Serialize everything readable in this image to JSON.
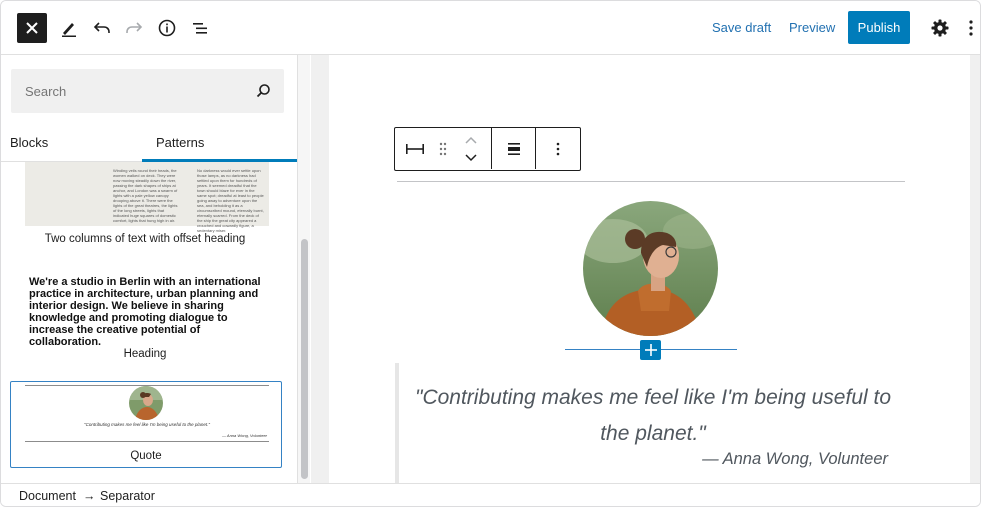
{
  "header": {
    "close_icon": "close-icon",
    "tools": [
      "edit-pencil-icon",
      "undo-icon",
      "redo-icon",
      "info-icon",
      "list-view-icon"
    ],
    "save_draft_label": "Save draft",
    "preview_label": "Preview",
    "publish_label": "Publish",
    "settings_icon": "gear-icon",
    "options_icon": "more-vertical-icon",
    "colors": {
      "accent": "#007cba",
      "link": "#2271b1"
    }
  },
  "inserter": {
    "search_placeholder": "Search",
    "tabs": [
      {
        "label": "Blocks",
        "active": false
      },
      {
        "label": "Patterns",
        "active": true
      }
    ],
    "patterns": [
      {
        "label": "Two columns of text with offset heading",
        "preview_col1": "Winding veils round their heads, the women walked on deck. They were now moving steadily down the river, passing the dark shapes of ships at anchor, and London was a swarm of lights with a pale yellow canopy drooping above it. There were the lights of the great theatres, the lights of the long streets, lights that indicated huge squares of domestic comfort, lights that hung high in air.",
        "preview_col2": "No darkness would ever settle upon those lamps, as no darkness had settled upon them for hundreds of years. It seemed dreadful that the town should blaze for ever in the same spot; dreadful at least to people going away to adventure upon the sea, and beholding it as a circumscribed mound, eternally burnt, eternally scarred. From the deck of the ship the great city appeared a crouched and cowardly figure, a sedentary miser."
      },
      {
        "label": "Heading",
        "preview_text": "We're a studio in Berlin with an international practice in architecture, urban planning and interior design. We believe in sharing knowledge and promoting dialogue to increase the creative potential of collaboration."
      },
      {
        "label": "Quote",
        "preview_quote": "\"Contributing makes me feel like I'm being useful to the planet.\"",
        "preview_cite": "— Anna Wong, Volunteer",
        "selected": true
      }
    ]
  },
  "block_toolbar": {
    "buttons": [
      "separator-block-icon",
      "drag-handle-icon",
      "move-up-icon",
      "move-down-icon",
      "align-icon",
      "more-options-icon"
    ]
  },
  "content": {
    "quote": "\"Contributing makes me feel like I'm being useful to the planet.\"",
    "citation": "— Anna Wong, Volunteer",
    "insert_icon": "plus-icon"
  },
  "footer": {
    "breadcrumb": [
      "Document",
      "Separator"
    ],
    "separator_glyph": "→"
  }
}
